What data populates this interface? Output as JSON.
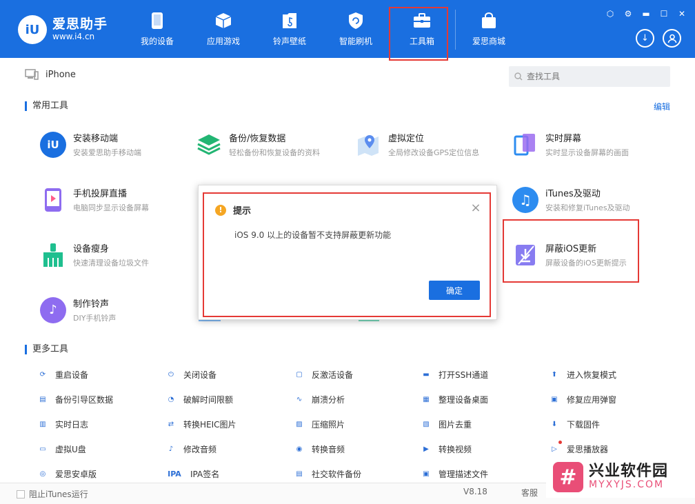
{
  "app": {
    "logo_badge": "iU",
    "logo_name": "爱思助手",
    "logo_url": "www.i4.cn",
    "brand_color": "#1a6fe0",
    "accent_red": "#e53935"
  },
  "nav": [
    {
      "label": "我的设备",
      "icon": "phone-icon"
    },
    {
      "label": "应用游戏",
      "icon": "cube-icon"
    },
    {
      "label": "铃声壁纸",
      "icon": "music-file-icon"
    },
    {
      "label": "智能刷机",
      "icon": "refresh-shield-icon"
    },
    {
      "label": "工具箱",
      "icon": "toolbox-icon",
      "active": true
    },
    {
      "label": "爱思商城",
      "icon": "shopping-bag-icon"
    }
  ],
  "device": {
    "name": "iPhone"
  },
  "search": {
    "placeholder": "查找工具"
  },
  "common_tools": {
    "title": "常用工具",
    "edit_label": "编辑",
    "items": [
      {
        "name": "安装移动端",
        "desc": "安装爱思助手移动端"
      },
      {
        "name": "备份/恢复数据",
        "desc": "轻松备份和恢复设备的资料"
      },
      {
        "name": "虚拟定位",
        "desc": "全局修改设备GPS定位信息"
      },
      {
        "name": "实时屏幕",
        "desc": "实时显示设备屏幕的画面"
      },
      {
        "name": "手机投屏直播",
        "desc": "电脑同步显示设备屏幕"
      },
      {
        "name": "iTunes及驱动",
        "desc": "安装和修复iTunes及驱动"
      },
      {
        "name": "设备瘦身",
        "desc": "快速清理设备垃圾文件"
      },
      {
        "name": "屏蔽iOS更新",
        "desc": "屏蔽设备的iOS更新提示"
      },
      {
        "name": "制作铃声",
        "desc": "DIY手机铃声"
      }
    ]
  },
  "more_tools": {
    "title": "更多工具",
    "items": [
      "重启设备",
      "关闭设备",
      "反激活设备",
      "打开SSH通道",
      "进入恢复模式",
      "备份引导区数据",
      "破解时间限额",
      "崩溃分析",
      "整理设备桌面",
      "修复应用弹窗",
      "实时日志",
      "转换HEIC图片",
      "压缩照片",
      "图片去重",
      "下载固件",
      "虚拟U盘",
      "修改音频",
      "转换音频",
      "转换视频",
      "爱思播放器",
      "爱思安卓版",
      "IPA签名",
      "社交软件备份",
      "管理描述文件"
    ]
  },
  "status": {
    "itunes_label": "阻止iTunes运行",
    "version": "V8.18",
    "service": "客服"
  },
  "dialog": {
    "title": "提示",
    "message": "iOS 9.0 以上的设备暂不支持屏蔽更新功能",
    "ok_label": "确定"
  },
  "watermark": {
    "cn": "兴业软件园",
    "en": "MYXYJS.COM"
  }
}
